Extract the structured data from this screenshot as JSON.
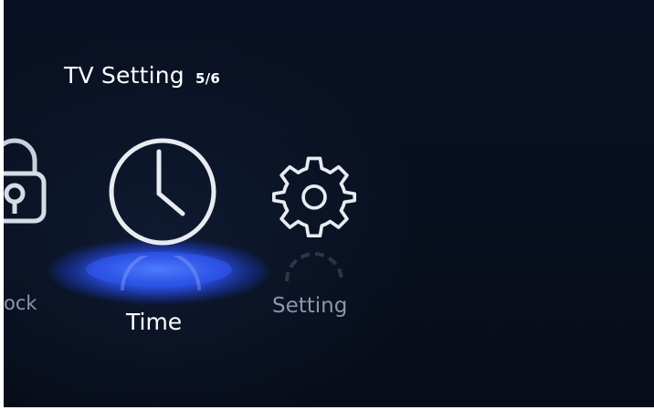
{
  "header": {
    "title": "TV Setting",
    "page_indicator": "5/6"
  },
  "menu": {
    "items": [
      {
        "label": "ock",
        "icon": "lock-icon",
        "state": "partially-visible"
      },
      {
        "label": "Time",
        "icon": "clock-icon",
        "state": "selected"
      },
      {
        "label": "Setting",
        "icon": "gear-icon",
        "state": "normal"
      }
    ]
  },
  "colors": {
    "background": "#08101f",
    "selected_text": "#ffffff",
    "unselected_text": "#8a96ad",
    "highlight_glow": "#3d6bff"
  }
}
